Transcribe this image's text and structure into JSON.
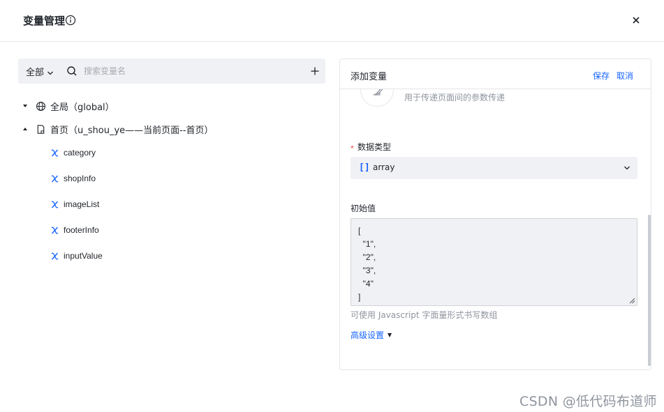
{
  "header": {
    "title": "变量管理"
  },
  "left_panel": {
    "scope_select": "全部",
    "search_placeholder": "搜索变量名",
    "tree": {
      "global": {
        "label": "全局（global）"
      },
      "page": {
        "label": "首页（u_shou_ye——当前页面--首页）",
        "variables": [
          "category",
          "shopInfo",
          "imageList",
          "footerInfo",
          "inputValue"
        ]
      }
    }
  },
  "form": {
    "title": "添加变量",
    "save_label": "保存",
    "cancel_label": "取消",
    "description": "用于传递页面间的参数传递",
    "data_type_label": "数据类型",
    "required_mark": "*",
    "data_type_icon": "[]",
    "data_type_value": "array",
    "initial_value_label": "初始值",
    "initial_value": "[\n  \"1\",\n  \"2\",\n  \"3\",\n  \"4\"\n]",
    "hint": "可使用 Javascript 字面量形式书写数组",
    "advanced_label": "高级设置"
  },
  "watermark": "CSDN @低代码布道师",
  "colors": {
    "accent": "#1664ff",
    "required": "#f54a45",
    "muted": "#8f959e",
    "input_bg": "#f0f1f4"
  }
}
